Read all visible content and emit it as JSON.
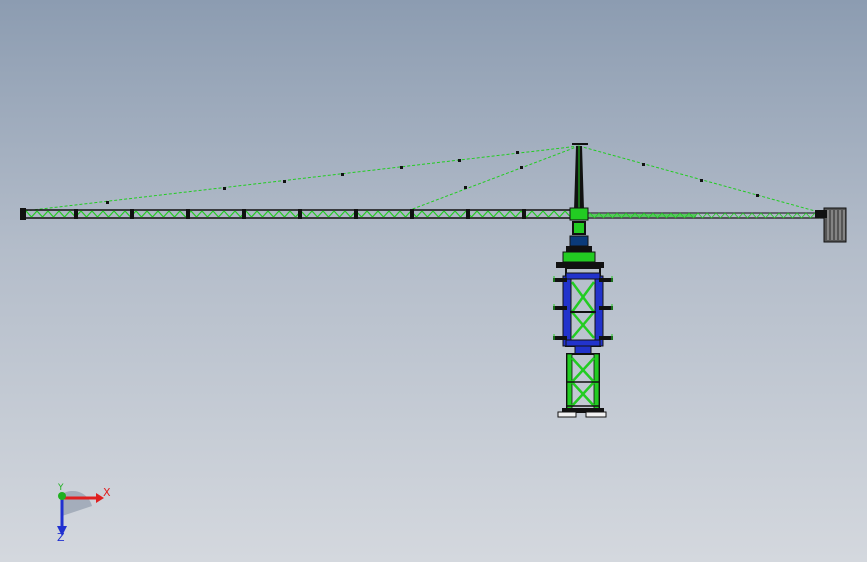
{
  "viewport": {
    "background_top": "#8c9cb1",
    "background_bottom": "#d4d8de"
  },
  "model": {
    "subject": "tower-crane",
    "colors": {
      "truss_green": "#22cc22",
      "mast_blue": "#2233cc",
      "outline_black": "#111111",
      "counterweight_gray": "#555555",
      "base_white": "#f2f2f2"
    }
  },
  "triad": {
    "x_label": "X",
    "y_label": "Y",
    "z_label": "Z",
    "x_color": "#e02020",
    "y_color": "#20b020",
    "z_color": "#2030d0"
  }
}
